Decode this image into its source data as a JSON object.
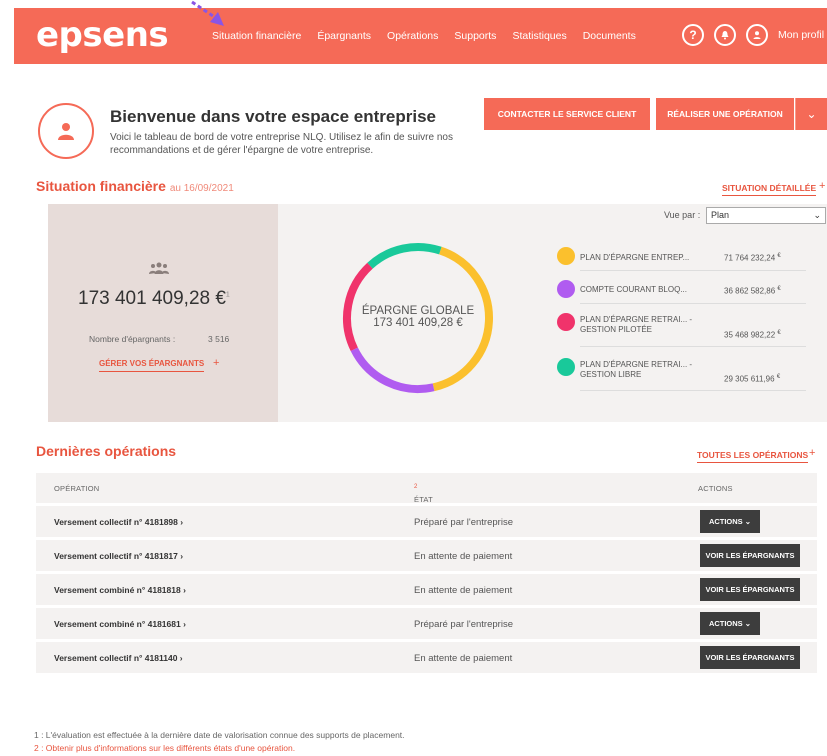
{
  "header": {
    "logo": "epsens",
    "nav": [
      "Situation financière",
      "Épargnants",
      "Opérations",
      "Supports",
      "Statistiques",
      "Documents"
    ],
    "help_icon_glyph": "?",
    "profile_label": "Mon profil"
  },
  "welcome": {
    "title": "Bienvenue dans votre espace entreprise",
    "text": "Voici le tableau de bord de votre entreprise NLQ. Utilisez le afin de suivre nos recommandations et de gérer l'épargne de votre entreprise."
  },
  "buttons": {
    "contact": "CONTACTER LE SERVICE CLIENT",
    "operation": "RÉALISER UNE OPÉRATION"
  },
  "financial": {
    "title": "Situation financière",
    "date": "au 16/09/2021",
    "detail_link": "SITUATION DÉTAILLÉE",
    "plus": "+",
    "total": "173 401 409,28 €",
    "total_note": "1",
    "nb_label": "Nombre d'épargnants :",
    "nb_value": "3 516",
    "manage_link": "GÉRER VOS ÉPARGNANTS",
    "donut_title": "ÉPARGNE GLOBALE",
    "donut_amount": "173 401 409,28 €",
    "view_label": "Vue par :",
    "view_value": "Plan",
    "legend": [
      {
        "name": "PLAN D'ÉPARGNE ENTREP...",
        "value": "71 764 232,24",
        "color": "#fbc02d"
      },
      {
        "name": "COMPTE COURANT BLOQ...",
        "value": "36 862 582,86",
        "color": "#b05cf0"
      },
      {
        "name": "PLAN D'ÉPARGNE RETRAI... - GESTION PILOTÉE",
        "value": "35 468 982,22",
        "color": "#f0336b"
      },
      {
        "name": "PLAN D'ÉPARGNE RETRAI... - GESTION LIBRE",
        "value": "29 305 611,96",
        "color": "#19c99a"
      }
    ],
    "currency": "€"
  },
  "operations": {
    "title": "Dernières opérations",
    "all_link": "TOUTES LES OPÉRATIONS",
    "columns": [
      "OPÉRATION",
      "ÉTAT",
      "ACTIONS"
    ],
    "state_note": "2",
    "rows": [
      {
        "op": "Versement collectif n° 4181898 ›",
        "state": "Préparé par l'entreprise",
        "action": "ACTIONS ⌄"
      },
      {
        "op": "Versement collectif n° 4181817 ›",
        "state": "En attente de paiement",
        "action": "VOIR LES ÉPARGNANTS"
      },
      {
        "op": "Versement combiné n° 4181818 ›",
        "state": "En attente de paiement",
        "action": "VOIR LES ÉPARGNANTS"
      },
      {
        "op": "Versement combiné n° 4181681 ›",
        "state": "Préparé par l'entreprise",
        "action": "ACTIONS ⌄"
      },
      {
        "op": "Versement collectif n° 4181140 ›",
        "state": "En attente de paiement",
        "action": "VOIR LES ÉPARGNANTS"
      }
    ]
  },
  "footnotes": [
    "1 : L'évaluation est effectuée à la dernière date de valorisation connue des supports de placement.",
    "2 : Obtenir plus d'informations sur les différents états d'une opération."
  ],
  "colors": {
    "brand": "#f56a57",
    "accent_text": "#e8553f"
  }
}
